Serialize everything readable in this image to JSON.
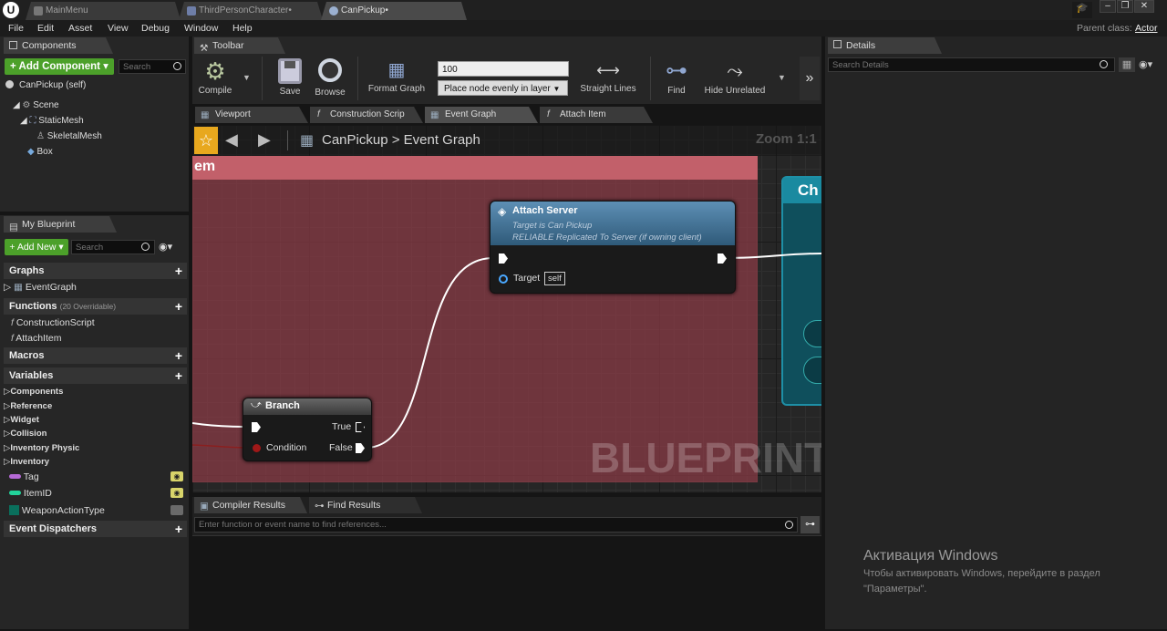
{
  "titlebar": {
    "tabs": [
      {
        "label": "MainMenu",
        "active": false
      },
      {
        "label": "ThirdPersonCharacter•",
        "active": false
      },
      {
        "label": "CanPickup•",
        "active": true
      }
    ],
    "parent_class_label": "Parent class:",
    "parent_class_value": "Actor"
  },
  "menubar": {
    "items": [
      "File",
      "Edit",
      "Asset",
      "View",
      "Debug",
      "Window",
      "Help"
    ]
  },
  "components": {
    "tab": "Components",
    "add_button": "Add Component",
    "search_placeholder": "Search",
    "self_label": "CanPickup (self)",
    "tree": [
      "Scene",
      "StaticMesh",
      "SkeletalMesh",
      "Box"
    ]
  },
  "my_blueprint": {
    "tab": "My Blueprint",
    "add_button": "Add New",
    "search_placeholder": "Search",
    "sections": {
      "graphs": "Graphs",
      "functions": "Functions",
      "functions_note": "(20 Overridable)",
      "macros": "Macros",
      "variables": "Variables",
      "dispatchers": "Event Dispatchers"
    },
    "graphs": [
      "EventGraph"
    ],
    "functions": [
      "ConstructionScript",
      "AttachItem"
    ],
    "variable_categories": [
      "Components",
      "Reference",
      "Widget",
      "Collision",
      "Inventory Physic",
      "Inventory"
    ],
    "variables": [
      {
        "name": "Tag",
        "color": "#b569d6"
      },
      {
        "name": "ItemID",
        "color": "#22d29a"
      },
      {
        "name": "WeaponActionType",
        "color": "#0a6f5c"
      }
    ]
  },
  "toolbar": {
    "tab": "Toolbar",
    "compile": "Compile",
    "save": "Save",
    "browse": "Browse",
    "format_graph": "Format Graph",
    "spacing_value": "100",
    "spacing_mode": "Place node evenly in layer",
    "straight_lines": "Straight Lines",
    "find": "Find",
    "hide_unrelated": "Hide Unrelated"
  },
  "graph_tabs": [
    "Viewport",
    "Construction Scrip",
    "Event Graph",
    "Attach Item"
  ],
  "graph": {
    "breadcrumb_root": "CanPickup",
    "breadcrumb_sep": ">",
    "breadcrumb_leaf": "Event Graph",
    "zoom": "Zoom 1:1",
    "comment_title": "em",
    "watermark": "BLUEPRINT",
    "attach_node": {
      "title": "Attach Server",
      "subtitle1": "Target is Can Pickup",
      "subtitle2": "RELIABLE Replicated To Server (if owning client)",
      "target_label": "Target",
      "target_value": "self"
    },
    "branch_node": {
      "title": "Branch",
      "true_label": "True",
      "condition_label": "Condition",
      "false_label": "False"
    },
    "right_node_title": "Ch"
  },
  "bottom": {
    "tabs": [
      "Compiler Results",
      "Find Results"
    ],
    "search_placeholder": "Enter function or event name to find references..."
  },
  "details": {
    "tab": "Details",
    "search_placeholder": "Search Details"
  },
  "activation": {
    "title": "Активация Windows",
    "line1": "Чтобы активировать Windows, перейдите в раздел",
    "line2": "\"Параметры\"."
  }
}
